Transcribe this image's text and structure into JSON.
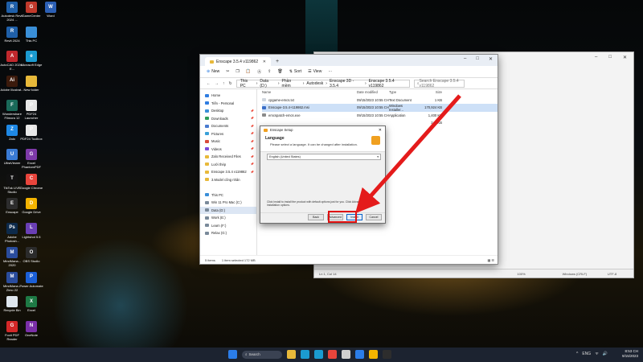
{
  "desktop": {
    "icons": [
      {
        "label": "Autodesk Revit 2024 ...",
        "color": "#1f5fa8",
        "glyph": "R",
        "col": 0,
        "row": 0
      },
      {
        "label": "GameCenter",
        "color": "#c0392b",
        "glyph": "G",
        "col": 1,
        "row": 0
      },
      {
        "label": "Word",
        "color": "#2b5fb4",
        "glyph": "W",
        "col": 2,
        "row": 0
      },
      {
        "label": "Revit 2024",
        "color": "#1f5fa8",
        "glyph": "R",
        "col": 0,
        "row": 1
      },
      {
        "label": "This PC",
        "color": "#3a8fd8",
        "glyph": "",
        "col": 1,
        "row": 1
      },
      {
        "label": "AutoCAD 2024 - E...",
        "color": "#c0282d",
        "glyph": "A",
        "col": 0,
        "row": 2
      },
      {
        "label": "Microsoft Edge",
        "color": "#1b9bd1",
        "glyph": "e",
        "col": 1,
        "row": 2
      },
      {
        "label": "Adobe Illustrat...",
        "color": "#3b1a0c",
        "glyph": "Ai",
        "col": 0,
        "row": 3
      },
      {
        "label": "New folder",
        "color": "#e8b93a",
        "glyph": "",
        "col": 1,
        "row": 3
      },
      {
        "label": "Wondershare Filmora 12",
        "color": "#1a6a5a",
        "glyph": "F",
        "col": 0,
        "row": 4
      },
      {
        "label": "PDF24 Launcher",
        "color": "#e7e7e7",
        "glyph": "P",
        "col": 1,
        "row": 4
      },
      {
        "label": "Zalo",
        "color": "#1e88e5",
        "glyph": "Z",
        "col": 0,
        "row": 5
      },
      {
        "label": "PDF24 Toolbox",
        "color": "#e7e7e7",
        "glyph": "P",
        "col": 1,
        "row": 5
      },
      {
        "label": "UltraViewer",
        "color": "#3a7bd5",
        "glyph": "U",
        "col": 0,
        "row": 6
      },
      {
        "label": "Excel PhantomPDF",
        "color": "#7e3aa8",
        "glyph": "G",
        "col": 1,
        "row": 6
      },
      {
        "label": "TikTok LIVE Studio",
        "color": "#111111",
        "glyph": "T",
        "col": 0,
        "row": 7
      },
      {
        "label": "Google Chrome",
        "color": "#e8453c",
        "glyph": "C",
        "col": 1,
        "row": 7
      },
      {
        "label": "Enscape",
        "color": "#2d2d2d",
        "glyph": "E",
        "col": 0,
        "row": 8
      },
      {
        "label": "Google Drive",
        "color": "#f4b400",
        "glyph": "D",
        "col": 1,
        "row": 8
      },
      {
        "label": "Adobe Photosh...",
        "color": "#0d2a4a",
        "glyph": "Ps",
        "col": 0,
        "row": 9
      },
      {
        "label": "Lightshot 5.5",
        "color": "#6a3fb5",
        "glyph": "L",
        "col": 1,
        "row": 9
      },
      {
        "label": "MindMana... 2020",
        "color": "#2a4c9c",
        "glyph": "M",
        "col": 0,
        "row": 10
      },
      {
        "label": "OBS Studio",
        "color": "#2b2b2b",
        "glyph": "O",
        "col": 1,
        "row": 10
      },
      {
        "label": "MindMana... Zimo 22",
        "color": "#2a4c9c",
        "glyph": "M",
        "col": 0,
        "row": 11
      },
      {
        "label": "Power Automate",
        "color": "#1b5fd6",
        "glyph": "P",
        "col": 1,
        "row": 11
      },
      {
        "label": "Recycle Bin",
        "color": "#dfe7ee",
        "glyph": "",
        "col": 0,
        "row": 12
      },
      {
        "label": "Excel",
        "color": "#1e7a45",
        "glyph": "X",
        "col": 1,
        "row": 12
      },
      {
        "label": "Foxit PDF Reader",
        "color": "#d42828",
        "glyph": "G",
        "col": 0,
        "row": 13
      },
      {
        "label": "OneNote",
        "color": "#7b2fa8",
        "glyph": "N",
        "col": 1,
        "row": 13
      }
    ]
  },
  "notepad": {
    "title": "cpgame-emcs.txt - Notepad",
    "status": [
      "Ln 1, Col 14",
      "100%",
      "Windows (CRLF)",
      "UTF-8"
    ]
  },
  "explorer": {
    "tab_title": "Enscape 3.5.4 v119862",
    "commands": [
      "New",
      "Sort",
      "View"
    ],
    "breadcrumb": [
      "This PC",
      "Data (D:)",
      "Phần mềm",
      "Autodesk",
      "Enscape 3D - 3.5.4",
      "Enscape 3.5.4 v119862"
    ],
    "search_placeholder": "Search Enscape 3.5.4 v119862",
    "nav": [
      {
        "label": "Home",
        "color": "#2f7de1",
        "pin": ""
      },
      {
        "label": "Tiến - Personal",
        "color": "#2f7de1",
        "pin": ""
      },
      {
        "label": "Desktop",
        "color": "#3a8fd8",
        "pin": "📌"
      },
      {
        "label": "Downloads",
        "color": "#2f9e5a",
        "pin": "📌"
      },
      {
        "label": "Documents",
        "color": "#4a7bd0",
        "pin": "📌"
      },
      {
        "label": "Pictures",
        "color": "#3aa0d8",
        "pin": "📌"
      },
      {
        "label": "Music",
        "color": "#d84a3a",
        "pin": "📌"
      },
      {
        "label": "Videos",
        "color": "#7a4ad8",
        "pin": "📌"
      },
      {
        "label": "Zalo Received Files",
        "color": "#e8b93a",
        "pin": "📌"
      },
      {
        "label": "Lưới thép",
        "color": "#e8b93a",
        "pin": "📌"
      },
      {
        "label": "Enscape 3.5.4 v119862",
        "color": "#e8b93a",
        "pin": "📌"
      },
      {
        "label": "3.Model công nhân",
        "color": "#e8b93a",
        "pin": ""
      },
      {
        "label": "",
        "color": "transparent",
        "pin": ""
      },
      {
        "label": "This PC",
        "color": "#3a8fd8",
        "pin": ""
      },
      {
        "label": "Win 11 Pro Mac (C:)",
        "color": "#7a8a9a",
        "pin": ""
      },
      {
        "label": "Data (D:)",
        "color": "#7a8a9a",
        "pin": "",
        "sel": true
      },
      {
        "label": "Work (E:)",
        "color": "#7a8a9a",
        "pin": ""
      },
      {
        "label": "Learn (F:)",
        "color": "#7a8a9a",
        "pin": ""
      },
      {
        "label": "Relax (G:)",
        "color": "#7a8a9a",
        "pin": ""
      }
    ],
    "columns": [
      "Name",
      "Date modified",
      "Type",
      "Size"
    ],
    "files": [
      {
        "name": "cpgame-emcs.txt",
        "date": "09/15/2023 10:55 CH",
        "type": "Text Document",
        "size": "1 KB",
        "color": "#d0d6de"
      },
      {
        "name": "Enscape-3.5.4+119862.msi",
        "date": "09/15/2023 10:55 CH",
        "type": "Windows Installer...",
        "size": "170,924 KB",
        "color": "#3a6fc8",
        "sel": true
      },
      {
        "name": "emcspatch-emcs.exe",
        "date": "09/15/2023 10:55 CH",
        "type": "Application",
        "size": "1,400 KB",
        "color": "#8a8a8a"
      },
      {
        "name": "",
        "date": "",
        "type": "",
        "size": "242 KB",
        "color": "transparent"
      },
      {
        "name": "",
        "date": "",
        "type": "",
        "size": "",
        "color": "transparent"
      },
      {
        "name": "",
        "date": "",
        "type": "",
        "size": "",
        "color": "transparent"
      },
      {
        "name": "",
        "date": "",
        "type": "",
        "size": "",
        "color": "transparent"
      }
    ],
    "status": [
      "5 items",
      "1 item selected  172 MB"
    ]
  },
  "dialog": {
    "title": "Enscape Setup",
    "heading": "Language",
    "subheading": "Please select a language. It can be changed after installation.",
    "language_value": "English (United States)",
    "info": "Click Install to install the product with default options just for you. Click Advanced to change installation options.",
    "buttons": {
      "back": "Back",
      "advanced": "Advanced",
      "install": "Install",
      "cancel": "Cancel"
    }
  },
  "taskbar": {
    "search_label": "Search",
    "app_colors": [
      "#2b7de9",
      "#3a4252",
      "#e8b93a",
      "#1b9bd1",
      "#1b9bd1",
      "#e8453c",
      "#d0d0d0",
      "#2b7de9",
      "#f4b400",
      "#2d2d2d"
    ],
    "time": "8:53 CH",
    "date": "9/15/2023",
    "tray": [
      "^",
      "ENG",
      "wifi",
      "🔊"
    ]
  }
}
